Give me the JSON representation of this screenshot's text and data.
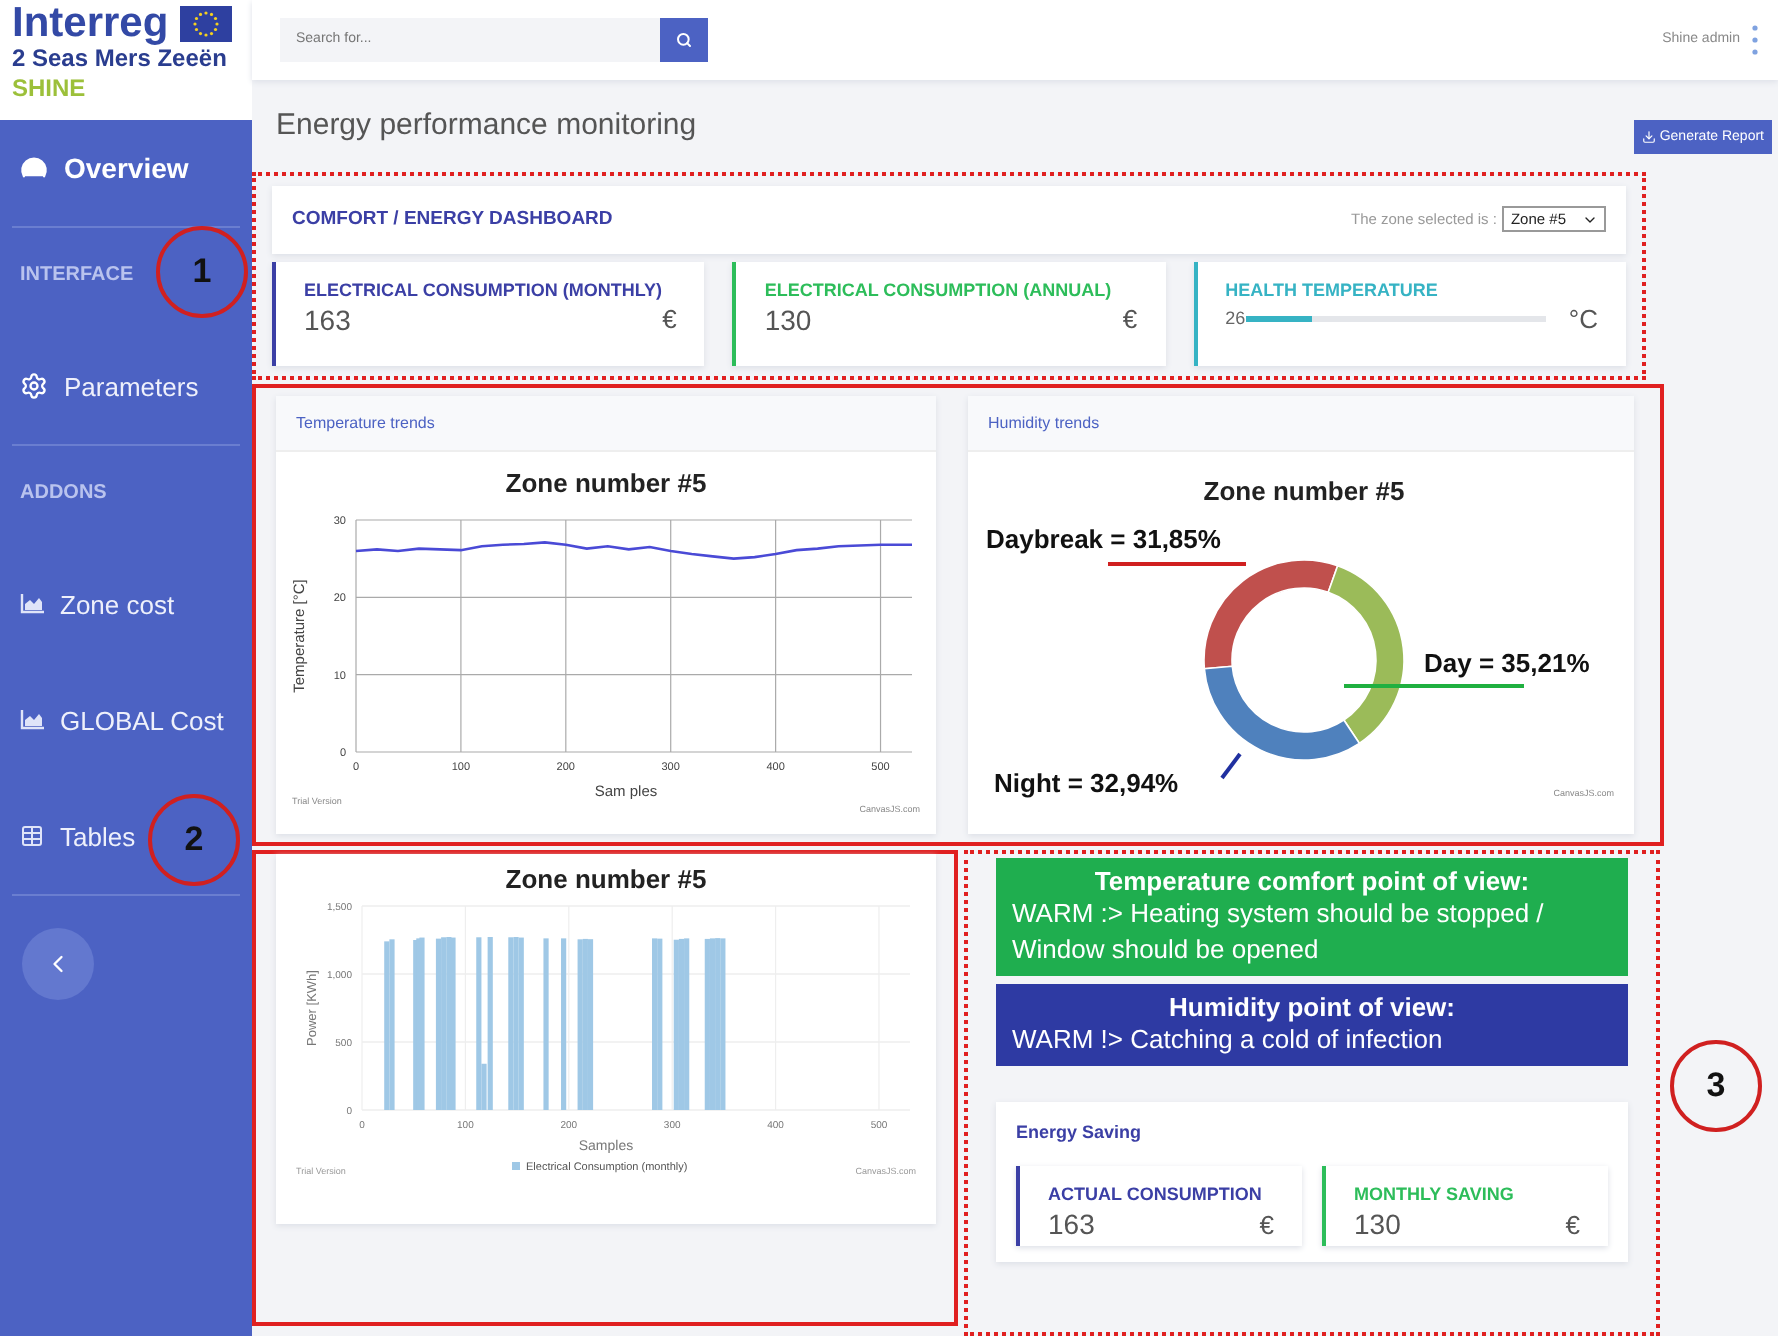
{
  "logo": {
    "brand": "Interreg",
    "program": "2 Seas Mers Zeeën",
    "project": "SHINE"
  },
  "sidebar": {
    "items": [
      {
        "kind": "link",
        "label": "Overview",
        "selected": true
      },
      {
        "kind": "section",
        "label": "INTERFACE"
      },
      {
        "kind": "link",
        "label": "Parameters",
        "selected": false
      },
      {
        "kind": "section",
        "label": "ADDONS"
      },
      {
        "kind": "link",
        "label": "Zone cost",
        "selected": false
      },
      {
        "kind": "link",
        "label": "GLOBAL Cost",
        "selected": false
      },
      {
        "kind": "link",
        "label": "Tables",
        "selected": false
      }
    ]
  },
  "topbar": {
    "search": {
      "placeholder": "Search for..."
    },
    "user": "Shine admin"
  },
  "page": {
    "title": "Energy performance monitoring",
    "action": "Generate Report"
  },
  "dashboard": {
    "title": "COMFORT / ENERGY DASHBOARD",
    "zone_label": "The zone selected is :",
    "zone": "Zone #5",
    "stats": [
      {
        "kind": "value",
        "label": "ELECTRICAL CONSUMPTION (MONTHLY)",
        "value": "163",
        "unit": "€",
        "color": "#3b3fa5"
      },
      {
        "kind": "value",
        "label": "ELECTRICAL CONSUMPTION (ANNUAL)",
        "value": "130",
        "unit": "€",
        "color": "#2dbd5a"
      },
      {
        "kind": "meter",
        "label": "HEALTH TEMPERATURE",
        "value": "26",
        "level": 0.22,
        "unit": "°C",
        "color": "#36b3c4"
      }
    ]
  },
  "temperature_trends": {
    "title": "Temperature trends",
    "footer_left": "Trial Version",
    "footer_right": "CanvasJS.com",
    "chart_data": {
      "type": "line",
      "title": "Zone number #5",
      "xlabel": "Sam ples",
      "ylabel": "Temperature [°C]",
      "x": [
        0,
        20,
        40,
        60,
        80,
        100,
        120,
        140,
        160,
        180,
        200,
        220,
        240,
        260,
        280,
        300,
        320,
        340,
        360,
        380,
        400,
        420,
        440,
        460,
        480,
        500,
        530
      ],
      "grid": true,
      "series": [
        {
          "color": "#4a4ad6",
          "values": [
            26,
            26.2,
            26,
            26.3,
            26.2,
            26.1,
            26.6,
            26.8,
            26.9,
            27.1,
            26.8,
            26.3,
            26.6,
            26.2,
            26.5,
            26,
            25.6,
            25.3,
            25,
            25.2,
            25.6,
            26.1,
            26.3,
            26.6,
            26.7,
            26.8,
            26.8
          ]
        }
      ],
      "xlim": [
        0,
        530
      ],
      "ylim": [
        0,
        30
      ],
      "xticks": [
        0,
        100,
        200,
        300,
        400,
        500
      ],
      "yticks": [
        0,
        10,
        20,
        30
      ]
    }
  },
  "humidity_trends": {
    "title": "Humidity trends",
    "footer_right": "CanvasJS.com",
    "chart_data": {
      "type": "donut",
      "title": "Zone number #5",
      "series": [
        {
          "values": [
            31.85,
            35.21,
            32.94
          ]
        }
      ],
      "colors": [
        "#c0504d",
        "#9bbb59",
        "#4f81bd"
      ],
      "annotations": [
        "Daybreak = 31,85%",
        "Day = 35,21%",
        "Night = 32,94%"
      ]
    }
  },
  "consumption": {
    "footer_left": "Trial Version",
    "footer_right": "CanvasJS.com",
    "chart_data": {
      "type": "bar",
      "title": "Zone number #5",
      "xlabel": "Samples",
      "ylabel": "Power [KWh]",
      "x": [
        24,
        29,
        52,
        55,
        58,
        74,
        79,
        84,
        88,
        113,
        118,
        124,
        144,
        149,
        154,
        178,
        195,
        211,
        216,
        221,
        283,
        288,
        304,
        309,
        314,
        334,
        339,
        344,
        349
      ],
      "grid": true,
      "series": [
        {
          "name": "Electrical Consumption (monthly)",
          "color": "#9fc8e6",
          "values": [
            1240,
            1255,
            1250,
            1262,
            1268,
            1260,
            1270,
            1272,
            1268,
            1270,
            340,
            1272,
            1270,
            1272,
            1268,
            1262,
            1262,
            1255,
            1258,
            1256,
            1262,
            1260,
            1252,
            1258,
            1262,
            1258,
            1262,
            1264,
            1262
          ]
        }
      ],
      "xlim": [
        0,
        530
      ],
      "ylim": [
        0,
        1500
      ],
      "xticks": [
        0,
        100,
        200,
        300,
        400,
        500
      ],
      "yticks": [
        0,
        500,
        {
          "value": 1000,
          "label": "1,000"
        },
        {
          "value": 1500,
          "label": "1,500"
        }
      ]
    }
  },
  "advice": [
    {
      "title": "Temperature comfort point of view:",
      "text": "WARM :> Heating system should be stopped / Window should be opened",
      "color": "#1fae4f"
    },
    {
      "title": "Humidity point of view:",
      "text": "WARM !> Catching a cold of infection",
      "color": "#2e3aa3"
    }
  ],
  "energy_saving": {
    "title": "Energy Saving",
    "stats": [
      {
        "label": "ACTUAL CONSUMPTION",
        "value": "163",
        "unit": "€",
        "color": "#3b3fa5"
      },
      {
        "label": "MONTHLY SAVING",
        "value": "130",
        "unit": "€",
        "color": "#2dbd5a"
      }
    ]
  },
  "callouts": [
    "1",
    "2",
    "3"
  ]
}
